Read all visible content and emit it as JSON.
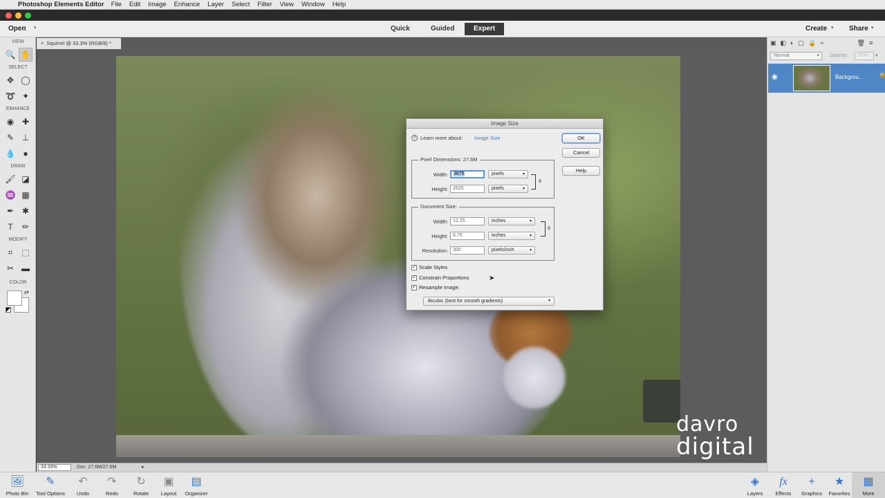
{
  "menubar": {
    "apple_glyph": "",
    "app_name": "Photoshop Elements Editor",
    "items": [
      "File",
      "Edit",
      "Image",
      "Enhance",
      "Layer",
      "Select",
      "Filter",
      "View",
      "Window",
      "Help"
    ]
  },
  "modebar": {
    "open_label": "Open",
    "arrow": "▾",
    "tabs": [
      "Quick",
      "Guided",
      "Expert"
    ],
    "active_tab": "Expert",
    "create_label": "Create",
    "share_label": "Share"
  },
  "toolbox": {
    "sections": [
      "VIEW",
      "SELECT",
      "ENHANCE",
      "DRAW",
      "MODIFY",
      "COLOR"
    ],
    "tools": [
      {
        "name": "zoom-tool",
        "glyph": "🔍"
      },
      {
        "name": "hand-tool",
        "glyph": "✋",
        "selected": true
      },
      {
        "name": "move-tool",
        "glyph": "✥"
      },
      {
        "name": "marquee-tool",
        "glyph": "◯"
      },
      {
        "name": "lasso-tool",
        "glyph": "➰"
      },
      {
        "name": "quick-selection-tool",
        "glyph": "✦"
      },
      {
        "name": "red-eye-tool",
        "glyph": "◉"
      },
      {
        "name": "spot-healing-tool",
        "glyph": "✚"
      },
      {
        "name": "smart-brush-tool",
        "glyph": "✎"
      },
      {
        "name": "clone-stamp-tool",
        "glyph": "⊥"
      },
      {
        "name": "blur-tool",
        "glyph": "💧"
      },
      {
        "name": "sponge-tool",
        "glyph": "●"
      },
      {
        "name": "brush-tool",
        "glyph": "🖌"
      },
      {
        "name": "eraser-tool",
        "glyph": "◪"
      },
      {
        "name": "paint-bucket-tool",
        "glyph": "♒"
      },
      {
        "name": "gradient-tool",
        "glyph": "▦"
      },
      {
        "name": "eyedropper-tool",
        "glyph": "✒"
      },
      {
        "name": "custom-shape-tool",
        "glyph": "✱"
      },
      {
        "name": "type-tool",
        "glyph": "T"
      },
      {
        "name": "pencil-tool",
        "glyph": "✏"
      },
      {
        "name": "crop-tool",
        "glyph": "⌗"
      },
      {
        "name": "recompose-tool",
        "glyph": "⬚"
      },
      {
        "name": "content-aware-move-tool",
        "glyph": "✂"
      },
      {
        "name": "straighten-tool",
        "glyph": "▬"
      }
    ]
  },
  "document": {
    "tab_close": "×",
    "tab_title": "Squirrel @ 33.3% (RGB/8) *"
  },
  "status": {
    "zoom": "33.33%",
    "doc_info": "Doc: 27.6M/27.6M",
    "arrow": "▸"
  },
  "watermark": {
    "line1": "davro",
    "line2": "digital"
  },
  "panel": {
    "blend_mode": "Normal",
    "opacity_label": "Opacity:",
    "opacity_value": "100%",
    "layer_name": "Backgrou...",
    "icons": [
      "new-layer",
      "new-group",
      "adjustment-layer",
      "mask",
      "lock",
      "delete"
    ]
  },
  "taskbar": {
    "left": [
      {
        "name": "photo-bin",
        "label": "Photo Bin",
        "glyph": "🖼"
      },
      {
        "name": "tool-options",
        "label": "Tool Options",
        "glyph": "✎"
      },
      {
        "name": "undo",
        "label": "Undo",
        "glyph": "↶"
      },
      {
        "name": "redo",
        "label": "Redo",
        "glyph": "↷"
      },
      {
        "name": "rotate",
        "label": "Rotate",
        "glyph": "↻"
      },
      {
        "name": "layout",
        "label": "Layout",
        "glyph": "▣"
      },
      {
        "name": "organizer",
        "label": "Organizer",
        "glyph": "▤"
      }
    ],
    "right": [
      {
        "name": "layers",
        "label": "Layers",
        "glyph": "◈"
      },
      {
        "name": "effects",
        "label": "Effects",
        "glyph": "fx"
      },
      {
        "name": "graphics",
        "label": "Graphics",
        "glyph": "+"
      },
      {
        "name": "favorites",
        "label": "Favorites",
        "glyph": "★"
      },
      {
        "name": "more",
        "label": "More",
        "glyph": "▦"
      }
    ]
  },
  "dialog": {
    "title": "Image Size",
    "learn_label": "Learn more about:",
    "learn_link": "Image Size",
    "ok": "OK",
    "cancel": "Cancel",
    "help": "Help",
    "pixel_dimensions": {
      "title": "Pixel Dimensions: 27.6M",
      "width_label": "Width:",
      "width_value": "3675",
      "width_unit": "pixels",
      "height_label": "Height:",
      "height_value": "2625",
      "height_unit": "pixels"
    },
    "document_size": {
      "title": "Document Size:",
      "width_label": "Width:",
      "width_value": "12.25",
      "width_unit": "inches",
      "height_label": "Height:",
      "height_value": "8.75",
      "height_unit": "inches",
      "resolution_label": "Resolution:",
      "resolution_value": "300",
      "resolution_unit": "pixels/inch"
    },
    "checkboxes": [
      {
        "label": "Scale Styles",
        "checked": true
      },
      {
        "label": "Constrain Proportions",
        "checked": true
      },
      {
        "label": "Resample Image:",
        "checked": true
      }
    ],
    "resample_method": "Bicubic (best for smooth gradients)",
    "caret": "▾",
    "check_glyph": "✓",
    "link_glyph": "8"
  }
}
